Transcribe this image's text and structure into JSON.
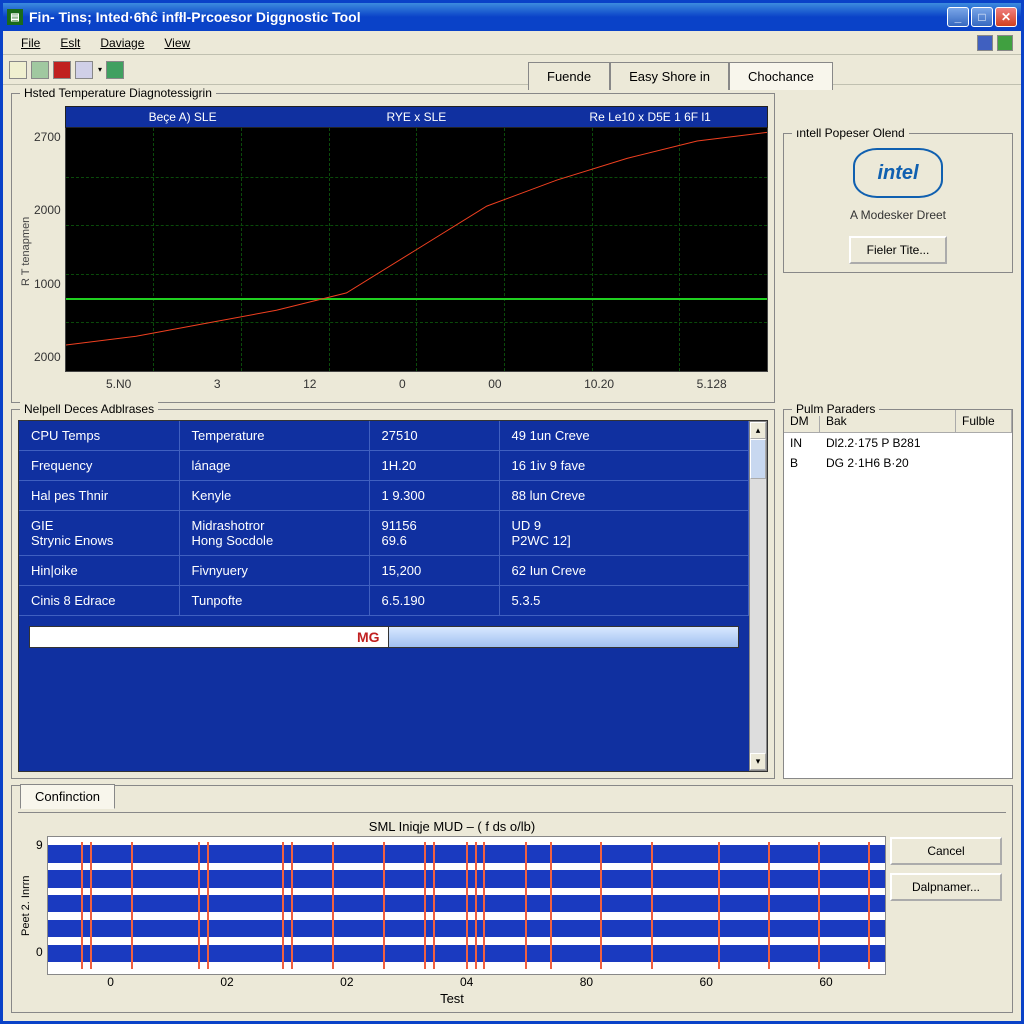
{
  "window": {
    "title": "Fin- Tins; Inted·6ħĉ infłl-Prcoesor Diggnostic Tool"
  },
  "menu": {
    "file": "File",
    "edit": "Eslt",
    "daviage": "Daviage",
    "view": "View"
  },
  "tabs_top": {
    "t1": "Fuende",
    "t2": "Easy Shore in",
    "t3": "Chochance"
  },
  "chart1": {
    "group_title": "Hsted Temperature Diagnotessigrin",
    "y_label": "R T tenapmen",
    "header": {
      "a": "Beçe A) SLE",
      "b": "RYE x SLE",
      "c": "Re Le10 x D5E 1 6F l1"
    },
    "yticks": {
      "y0": "2700",
      "y1": "2000",
      "y2": "1000",
      "y3": "2000"
    },
    "xticks": {
      "x0": "5.N0",
      "x1": "3",
      "x2": "12",
      "x3": "0",
      "x4": "00",
      "x5": "10.20",
      "x6": "5.128"
    }
  },
  "intel": {
    "group_title": "ıntell Popeser Olend",
    "logo_text": "intel",
    "subtitle": "A Modesker Dreet",
    "button": "Fieler Tite..."
  },
  "params": {
    "group_title": "Pulm Paraders",
    "cols": {
      "c0": "DM",
      "c1": "Bak",
      "c2": "Fulble"
    },
    "rows": [
      {
        "c0": "IN",
        "c1": "Dl2.2·175 P B281",
        "c2": ""
      },
      {
        "c0": "B",
        "c1": "DG 2·1H6 B·20",
        "c2": ""
      }
    ]
  },
  "table": {
    "group_title": "Nelpell Deces Adblrases",
    "rows": [
      {
        "c0": "CPU Temps",
        "c1": "Temperature",
        "c2": "27510",
        "c3": "49 1un Creve"
      },
      {
        "c0": "Frequency",
        "c1": "lánage",
        "c2": "1H.20",
        "c3": "16 1iv 9 fave"
      },
      {
        "c0": "Hal pes Thnir",
        "c1": "Kenyle",
        "c2": "1 9.300",
        "c3": "88 lun Creve"
      },
      {
        "c0": "GIE\nStrynic Enows",
        "c1": "Midrashotror\nHong Socdole",
        "c2": "91156\n69.6",
        "c3": "UD 9\nP2WC 12]"
      },
      {
        "c0": "Hin|oike",
        "c1": "Fivnyuery",
        "c2": "15,200",
        "c3": "62 Iun Creve"
      },
      {
        "c0": "Cinis 8 Edrace",
        "c1": "Tunpofte",
        "c2": "6.5.190",
        "c3": "5.3.5"
      }
    ],
    "progress_label": "MG"
  },
  "chart2": {
    "tab": "Confinction",
    "title": "SML Iniqje MUD – ( f ds o/lb)",
    "y_label": "Peet 2. Inrrn",
    "yticks": {
      "y0": "9",
      "y1": "0"
    },
    "xticks": {
      "x0": "0",
      "x1": "02",
      "x2": "02",
      "x3": "04",
      "x4": "80",
      "x5": "60",
      "x6": "60"
    },
    "x_label": "Test"
  },
  "buttons": {
    "cancel": "Cancel",
    "dalp": "Dalpnamer..."
  },
  "chart_data": [
    {
      "type": "line",
      "title": "Hsted Temperature Diagnotessigrin",
      "xlabel": "",
      "ylabel": "R T tenapmen",
      "x_tick_labels": [
        "5.N0",
        "3",
        "12",
        "0",
        "00",
        "10.20",
        "5.128"
      ],
      "y_tick_labels": [
        "2700",
        "2000",
        "1000",
        "2000"
      ],
      "series": [
        {
          "name": "red-curve",
          "color": "#f04020",
          "x": [
            0,
            1,
            2,
            3,
            4,
            5,
            6,
            7,
            8,
            9,
            10
          ],
          "y": [
            300,
            400,
            550,
            700,
            900,
            1400,
            1900,
            2200,
            2450,
            2650,
            2750
          ]
        },
        {
          "name": "green-threshold",
          "color": "#20d020",
          "x": [
            0,
            10
          ],
          "y": [
            900,
            900
          ]
        }
      ],
      "ylim": [
        0,
        2800
      ],
      "xlim": [
        0,
        10
      ],
      "legend": [
        "Beçe A) SLE",
        "RYE x SLE",
        "Re Le10 x D5E 1 6F l1"
      ]
    },
    {
      "type": "bar",
      "title": "SML Iniqje MUD – ( f ds o/lb)",
      "xlabel": "Test",
      "ylabel": "Peet 2. Inrrn",
      "lanes": 5,
      "x_tick_labels": [
        "0",
        "02",
        "02",
        "04",
        "80",
        "60",
        "60"
      ],
      "y_tick_labels": [
        "9",
        "0"
      ],
      "ylim": [
        0,
        9
      ],
      "spikes_x": [
        0.04,
        0.05,
        0.1,
        0.18,
        0.19,
        0.28,
        0.29,
        0.34,
        0.4,
        0.45,
        0.46,
        0.5,
        0.51,
        0.52,
        0.57,
        0.6,
        0.66,
        0.72,
        0.8,
        0.86,
        0.92,
        0.98
      ]
    }
  ]
}
